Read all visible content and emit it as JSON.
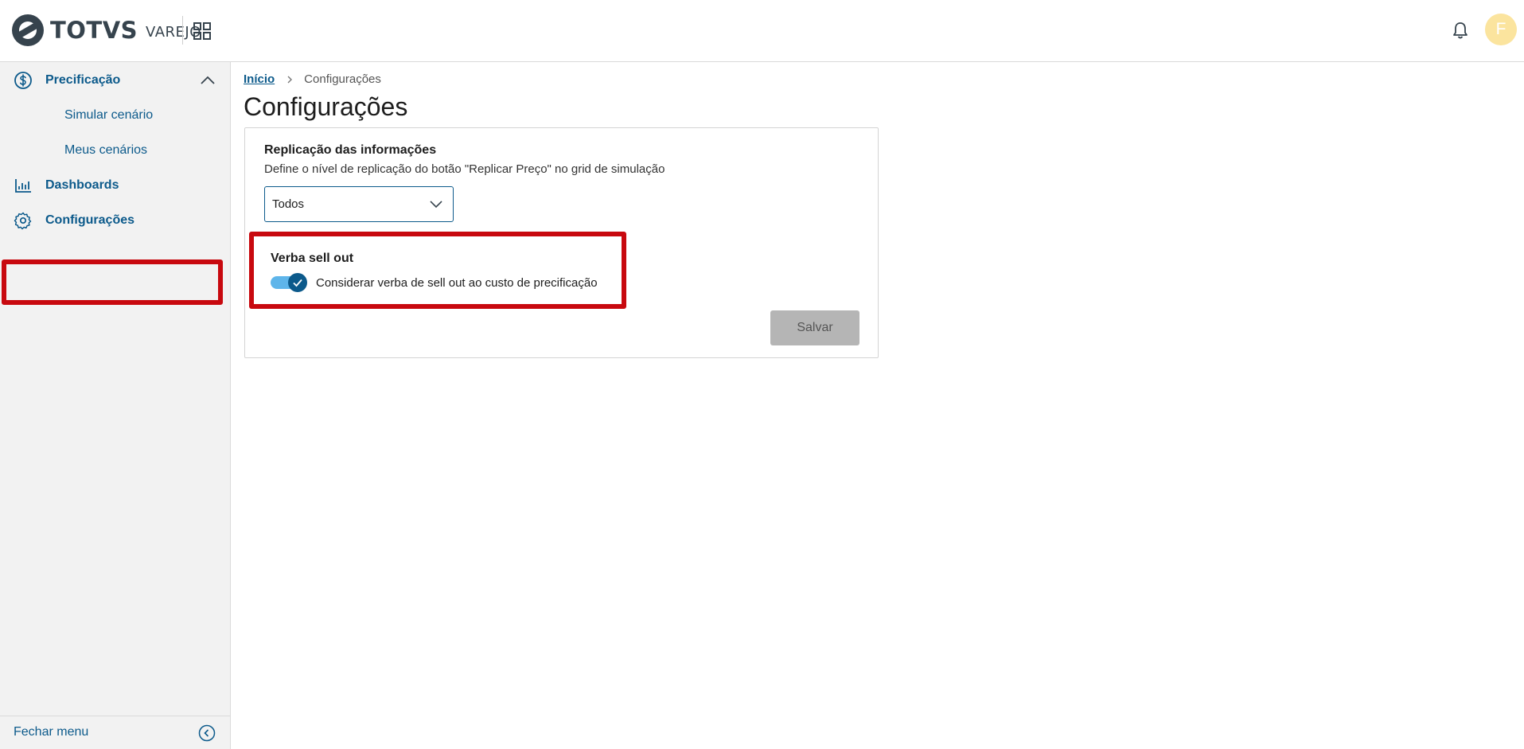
{
  "header": {
    "brand": "TOTVS",
    "product": "VAREJO",
    "avatar_initial": "F"
  },
  "sidebar": {
    "items": [
      {
        "label": "Precificação",
        "icon": "dollar-circle-icon"
      },
      {
        "label": "Simular cenário"
      },
      {
        "label": "Meus cenários"
      },
      {
        "label": "Dashboards",
        "icon": "bar-chart-icon"
      },
      {
        "label": "Configurações",
        "icon": "gear-icon"
      }
    ],
    "footer_label": "Fechar menu"
  },
  "breadcrumb": {
    "home": "Início",
    "current": "Configurações"
  },
  "page": {
    "title": "Configurações"
  },
  "settings": {
    "replication": {
      "title": "Replicação das informações",
      "description": "Define o nível de replicação do botão \"Replicar Preço\" no grid de simulação",
      "selected": "Todos"
    },
    "sellout": {
      "title": "Verba sell out",
      "toggle_label": "Considerar verba de sell out ao custo de precificação",
      "enabled": true
    },
    "save_label": "Salvar"
  },
  "colors": {
    "accent": "#0c5a8b",
    "highlight": "#c8090f",
    "toggle_track": "#5eb5ea",
    "avatar": "#fbe49e"
  }
}
